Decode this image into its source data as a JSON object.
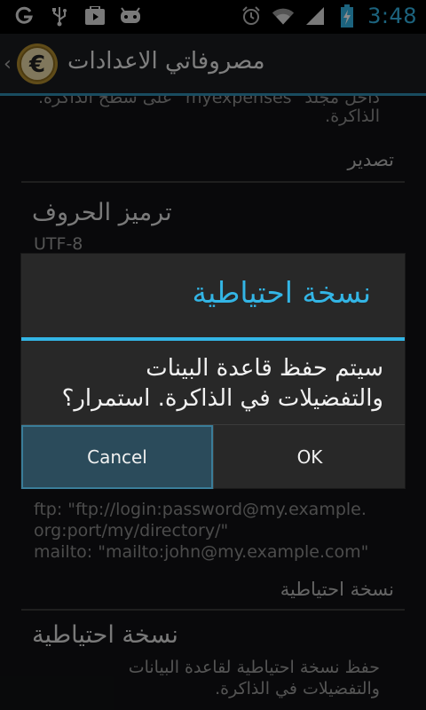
{
  "statusbar": {
    "time": "3:48",
    "left_icons": [
      "google-g-icon",
      "usb-icon",
      "play-store-icon",
      "android-icon"
    ],
    "right_icons": [
      "alarm-icon",
      "wifi-icon",
      "signal-icon",
      "battery-charging-icon"
    ]
  },
  "actionbar": {
    "title": "مصروفاتي الاعدادات",
    "logo": "euro-coin-icon"
  },
  "prefs": {
    "cut_summary": "داخل مجلد \"myexpenses\" على سطح الذاكرة.",
    "cut_summary_line2": "الذاكرة.",
    "category_export": "تصدير",
    "encoding_title": "ترميز الحروف",
    "encoding_value": "UTF-8",
    "ftp_lines": [
      "ftp: \"ftp://login:password@my.example.",
      "org:port/my/directory/\"",
      "mailto: \"mailto:john@my.example.com\""
    ],
    "category_backup": "نسخة احتياطية",
    "backup_title": "نسخة احتياطية",
    "backup_summary_line1": "حفظ نسخة احتياطية لقاعدة البيانات",
    "backup_summary_line2": "والتفضيلات في الذاكرة."
  },
  "dialog": {
    "title": "نسخة احتياطية",
    "message_line1": "سيتم حفظ قاعدة البينات",
    "message_line2": "والتفضيلات في الذاكرة. استمرار؟",
    "cancel_label": "Cancel",
    "ok_label": "OK"
  },
  "colors": {
    "accent": "#33b5e5",
    "cancel_pressed": "#2b4b5b"
  }
}
